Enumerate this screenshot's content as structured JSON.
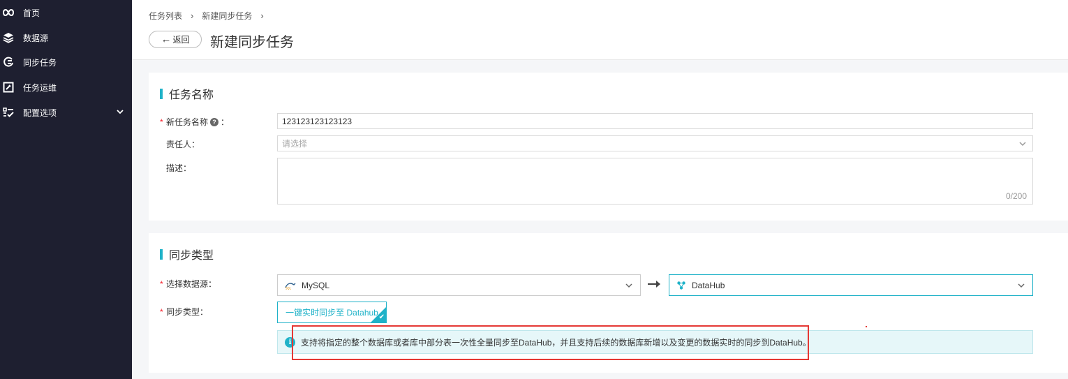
{
  "sidebar": {
    "items": [
      {
        "label": "首页",
        "icon": "infinity-icon"
      },
      {
        "label": "数据源",
        "icon": "layers-icon"
      },
      {
        "label": "同步任务",
        "icon": "sync-icon"
      },
      {
        "label": "任务运维",
        "icon": "wrench-icon"
      },
      {
        "label": "配置选项",
        "icon": "checklist-icon"
      }
    ]
  },
  "header": {
    "breadcrumb": [
      "任务列表",
      "新建同步任务"
    ],
    "back_label": "返回",
    "title": "新建同步任务"
  },
  "task_section": {
    "title": "任务名称",
    "name_label": "新任务名称",
    "name_value": "123123123123123",
    "owner_label": "责任人",
    "owner_placeholder": "请选择",
    "desc_label": "描述",
    "desc_counter": "0/200",
    "colon": "："
  },
  "sync_section": {
    "title": "同步类型",
    "source_label": "选择数据源",
    "source_value": "MySQL",
    "target_value": "DataHub",
    "type_label": "同步类型",
    "type_option": "一键实时同步至 Datahub",
    "info_text": "支持将指定的整个数据库或者库中部分表一次性全量同步至DataHub，并且支持后续的数据库新增以及变更的数据实时的同步到DataHub。"
  },
  "colors": {
    "sidebar_bg": "#1e1f30",
    "accent": "#1fb2c8",
    "required": "#f5222d",
    "highlight": "#e53935"
  }
}
